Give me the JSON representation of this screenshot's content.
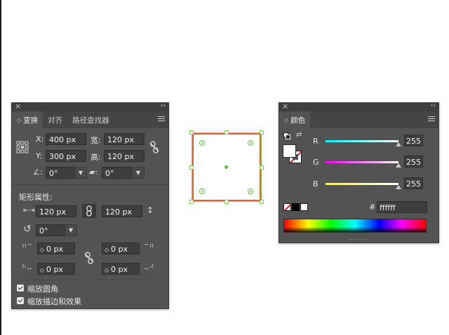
{
  "transform_panel": {
    "tabs": [
      "变换",
      "对齐",
      "路径查找器"
    ],
    "x_label": "X:",
    "x_value": "400 px",
    "width_label": "宽:",
    "width_value": "120 px",
    "y_label": "Y:",
    "y_value": "300 px",
    "height_label": "高:",
    "height_value": "120 px",
    "rotate_value": "0°",
    "shear_value": "0°",
    "rect_props_title": "矩形属性:",
    "rect_width": "120 px",
    "rect_height": "120 px",
    "rect_rotate": "0°",
    "corner_tl": "0 px",
    "corner_tr": "0 px",
    "corner_bl": "0 px",
    "corner_br": "0 px",
    "scale_corners_label": "缩放圆角",
    "scale_strokes_label": "缩放描边和效果"
  },
  "color_panel": {
    "tab": "颜色",
    "r_label": "R",
    "r_value": "255",
    "g_label": "G",
    "g_value": "255",
    "b_label": "B",
    "b_value": "255",
    "hex_label": "#",
    "hex_value": "ffffff"
  },
  "colors": {
    "panel_bg": "#535353",
    "stroke": "#e0632a",
    "selection": "#7ad84e"
  }
}
